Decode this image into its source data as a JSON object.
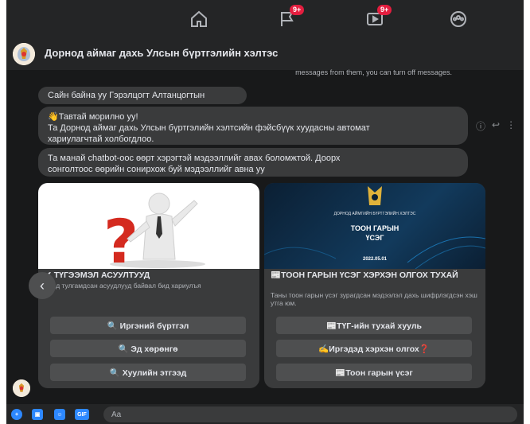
{
  "nav": {
    "friends_badge": "9+",
    "watch_badge": "9+"
  },
  "header": {
    "title": "Дорнод аймаг дахь Улсын бүртгэлийн хэлтэс"
  },
  "system_note": "messages from them, you can turn off messages.",
  "messages": [
    {
      "text": "Сайн байна уу Гэрэлцогт Алтанцогтын"
    },
    {
      "line1": "👋Тавтай морилно уу!",
      "line2": "Та Дорнод аймаг дахь Улсын бүртгэлийн хэлтсийн фэйсбүүк хуудасны автомат",
      "line3": "хариулагчтай холбогдлоо."
    },
    {
      "line1": "Та манай chatbot-оос өөрт хэрэгтэй мэдээллийг авах боломжтой. Доорх",
      "line2": "сонголтоос өөрийн сонирхож буй мэдээллийг авна уу"
    }
  ],
  "cards": [
    {
      "title": "✔ ТҮГЭЭМЭЛ АСУУЛТУУД",
      "subtitle": "Танд тулгамдсан асуудлууд байвал бид хариулъя",
      "buttons": [
        "🔍 Иргэний бүртгэл",
        "🔍 Эд хөрөнгө",
        "🔍 Хуулийн этгээд"
      ]
    },
    {
      "title": "📰ТООН ГАРЫН ҮСЭГ ХЭРХЭН ОЛГОХ ТУХАЙ",
      "subtitle": "Таны тоон гарын үсэг зурагдсан мэдээлэл дахь шифрлэгдсэн хэш утга юм.",
      "image_org": "ДОРНОД АЙМГИЙН БҮРТГЭЛИЙН ХЭЛТЭС",
      "image_title_1": "ТООН ГАРЫН",
      "image_title_2": "ҮСЭГ",
      "image_date": "2022.05.01",
      "buttons": [
        "📰ТҮГ-ийн тухай хууль",
        "✍Иргэдэд хэрхэн олгох❓",
        "📰Тоон гарын үсэг"
      ]
    }
  ],
  "composer": {
    "placeholder": "Aa",
    "gif_label": "GIF"
  },
  "colors": {
    "background": "#18191a",
    "bubble": "#3a3b3c",
    "accent": "#2d88ff",
    "badge": "#e41e3f"
  }
}
